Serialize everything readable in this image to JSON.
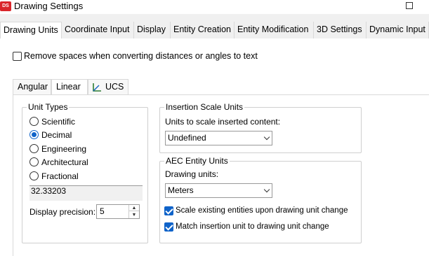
{
  "window": {
    "title": "Drawing Settings",
    "app_icon_text": "DS"
  },
  "tabs": [
    {
      "label": "Drawing Units",
      "active": true
    },
    {
      "label": "Coordinate Input"
    },
    {
      "label": "Display"
    },
    {
      "label": "Entity Creation"
    },
    {
      "label": "Entity Modification"
    },
    {
      "label": "3D Settings"
    },
    {
      "label": "Dynamic Input"
    }
  ],
  "remove_spaces": {
    "label": "Remove spaces when converting distances or angles to text",
    "checked": false
  },
  "subtabs": [
    {
      "label": "Angular"
    },
    {
      "label": "Linear",
      "active": true
    },
    {
      "label": "UCS",
      "icon": "ucs-icon"
    }
  ],
  "unit_types": {
    "title": "Unit Types",
    "options": [
      {
        "label": "Scientific",
        "selected": false
      },
      {
        "label": "Decimal",
        "selected": true
      },
      {
        "label": "Engineering",
        "selected": false
      },
      {
        "label": "Architectural",
        "selected": false
      },
      {
        "label": "Fractional",
        "selected": false
      }
    ],
    "preview": "32.33203",
    "precision_label": "Display precision:",
    "precision_value": "5"
  },
  "insertion_scale": {
    "title": "Insertion Scale Units",
    "label": "Units to scale inserted content:",
    "value": "Undefined"
  },
  "aec_units": {
    "title": "AEC Entity Units",
    "label": "Drawing units:",
    "value": "Meters",
    "scale_existing": {
      "label": "Scale existing entities upon drawing unit change",
      "checked": true
    },
    "match_insertion": {
      "label": "Match insertion unit to drawing unit change",
      "checked": true
    }
  },
  "colors": {
    "accent": "#0f63c9",
    "app_icon": "#d9262b"
  }
}
